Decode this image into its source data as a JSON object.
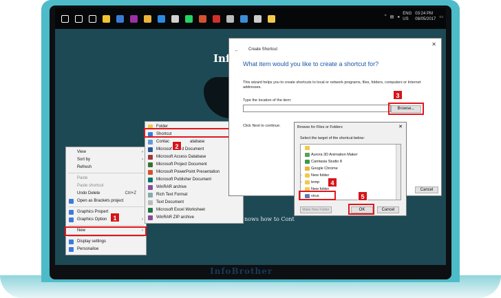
{
  "taskbar": {
    "icons": [
      {
        "name": "windows-start-icon",
        "color": "#ffffff"
      },
      {
        "name": "cortana-search-icon",
        "color": "#ffffff"
      },
      {
        "name": "task-view-icon",
        "color": "#ffffff"
      },
      {
        "name": "file-explorer-icon",
        "color": "#f1c232"
      },
      {
        "name": "store-icon",
        "color": "#3b7bd8"
      },
      {
        "name": "onenote-icon",
        "color": "#9c2fa6"
      },
      {
        "name": "chrome-icon",
        "color": "#e8b43c"
      },
      {
        "name": "edge-icon",
        "color": "#2c8be0"
      },
      {
        "name": "mail-icon",
        "color": "#d0d0d0"
      },
      {
        "name": "whatsapp-icon",
        "color": "#25d366"
      },
      {
        "name": "powerpoint-icon",
        "color": "#d35230"
      },
      {
        "name": "pdf-icon",
        "color": "#d0302b"
      },
      {
        "name": "camera-icon",
        "color": "#bbbbbb"
      },
      {
        "name": "photos-icon",
        "color": "#3b8ed8"
      },
      {
        "name": "printer-icon",
        "color": "#cccccc"
      },
      {
        "name": "notes-icon",
        "color": "#f2c94c"
      }
    ],
    "lang_top": "ENG",
    "lang_bottom": "US",
    "time": "03:24 PM",
    "date": "08/05/2017"
  },
  "background": {
    "title": "Info",
    "text": "nows how to Cont"
  },
  "context_menu": {
    "items": [
      {
        "label": "View",
        "arrow": true
      },
      {
        "label": "Sort by",
        "arrow": true
      },
      {
        "label": "Refresh"
      },
      {
        "sep": true
      },
      {
        "label": "Paste",
        "disabled": true
      },
      {
        "label": "Paste shortcut",
        "disabled": true
      },
      {
        "label": "Undo Delete",
        "accel": "Ctrl+Z"
      },
      {
        "label": "Open as Brackets project",
        "icon": "#3b7bd8"
      },
      {
        "sep": true
      },
      {
        "label": "Graphics Propert",
        "icon": "#3b7bd8"
      },
      {
        "label": "Graphics Option",
        "icon": "#3b7bd8",
        "arrow": true
      },
      {
        "sep": true
      },
      {
        "label": "New",
        "arrow": true
      },
      {
        "sep": true
      },
      {
        "label": "Display settings",
        "icon": "#3b7bd8"
      },
      {
        "label": "Personalise",
        "icon": "#3b7bd8"
      }
    ]
  },
  "new_menu": {
    "items": [
      {
        "label": "Folder",
        "icon": "#f2c94c"
      },
      {
        "label": "Shortcut",
        "icon": "#3b7bd8"
      },
      {
        "label": "Contac",
        "suffix": "atabase",
        "icon": "#6a9ad8"
      },
      {
        "label": "Microsoft Word Document",
        "icon": "#2b5797"
      },
      {
        "label": "Microsoft Access Database",
        "icon": "#a4373a"
      },
      {
        "label": "Microsoft Project Document",
        "icon": "#31752f"
      },
      {
        "label": "Microsoft PowerPoint Presentation",
        "icon": "#d35230"
      },
      {
        "label": "Microsoft Publisher Document",
        "icon": "#077568"
      },
      {
        "label": "WinRAR archive",
        "icon": "#8a4b9c"
      },
      {
        "label": "Rich Text Format",
        "icon": "#8aa"
      },
      {
        "label": "Text Document",
        "icon": "#bbb"
      },
      {
        "label": "Microsoft Excel Worksheet",
        "icon": "#217346"
      },
      {
        "label": "WinRAR ZIP archive",
        "icon": "#8a4b9c"
      }
    ]
  },
  "create_shortcut": {
    "title": "Create Shortcut",
    "heading": "What item would you like to create a shortcut for?",
    "description": "This wizard helps you to create shortcuts to local or network programs, files, folders, computers or Internet addresses.",
    "location_label": "Type the location of the item:",
    "location_value": "",
    "browse_label": "Browse...",
    "hint": "Click Next to continue.",
    "cancel_label": "Cancel"
  },
  "browse_dialog": {
    "title": "Browse for Files or Folders",
    "select_label": "Select the target of the shortcut below:",
    "items": [
      {
        "label": "",
        "icon": "#f2c94c"
      },
      {
        "label": "Aurora 3D Animation Maker",
        "icon": "#5aa05a"
      },
      {
        "label": "Camtasia Studio 8",
        "icon": "#3a9a4a"
      },
      {
        "label": "Google Chrome",
        "icon": "#e8b43c"
      },
      {
        "label": "New folder",
        "icon": "#f2c94c"
      },
      {
        "label": "temp",
        "icon": "#f2c94c"
      },
      {
        "label": "New folder",
        "icon": "#f2c94c"
      },
      {
        "label": "virus",
        "icon": "#5a7ab8"
      }
    ],
    "make_folder_label": "Make New Folder",
    "ok_label": "OK",
    "cancel_label": "Cancel"
  },
  "steps": [
    "1",
    "2",
    "3",
    "4",
    "5"
  ],
  "brand": "InfoBrother"
}
